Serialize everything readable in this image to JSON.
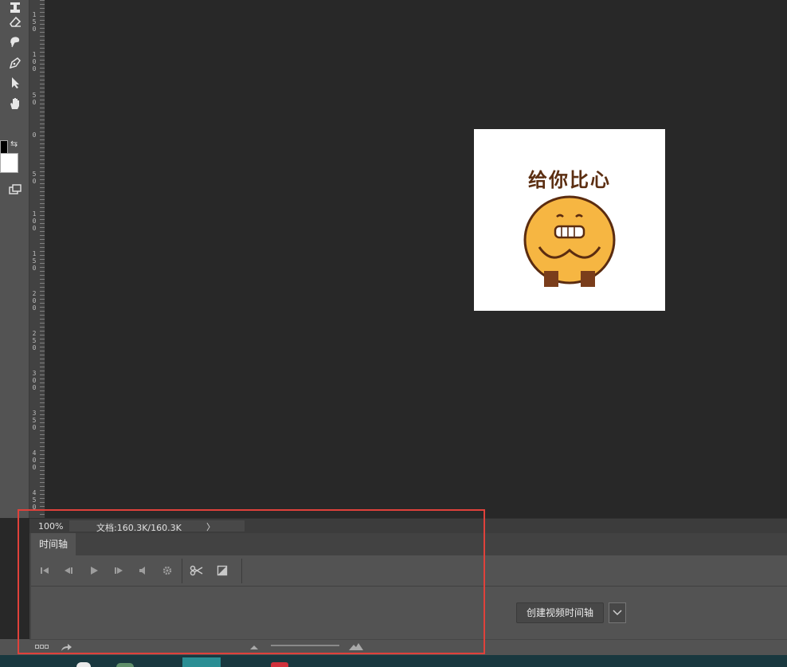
{
  "toolbar": {
    "tools": [
      {
        "name": "stamp-icon",
        "glyph": "⊥"
      },
      {
        "name": "eraser-icon",
        "glyph": "◇"
      },
      {
        "name": "smudge-icon",
        "glyph": "☛"
      },
      {
        "name": "pen-icon",
        "glyph": "✒"
      },
      {
        "name": "path-selection-icon",
        "glyph": "➤"
      },
      {
        "name": "hand-icon",
        "glyph": "✋"
      },
      {
        "name": "screen-mode-icon",
        "glyph": "▭"
      }
    ],
    "foreground_color": "#000000",
    "background_color": "#ffffff"
  },
  "ruler": {
    "labels": [
      "150",
      "100",
      "50",
      "0",
      "50",
      "100",
      "150",
      "200",
      "250",
      "300",
      "350",
      "400",
      "450"
    ]
  },
  "document": {
    "image_text": "给你比心"
  },
  "status_bar": {
    "zoom": "100%",
    "doc_info": "文档:160.3K/160.3K",
    "arrow": "〉"
  },
  "timeline": {
    "tab_label": "时间轴",
    "create_button_label": "创建视频时间轴"
  },
  "colors": {
    "highlight": "#e0413b",
    "panel": "#535353",
    "canvas_bg": "#282828"
  }
}
